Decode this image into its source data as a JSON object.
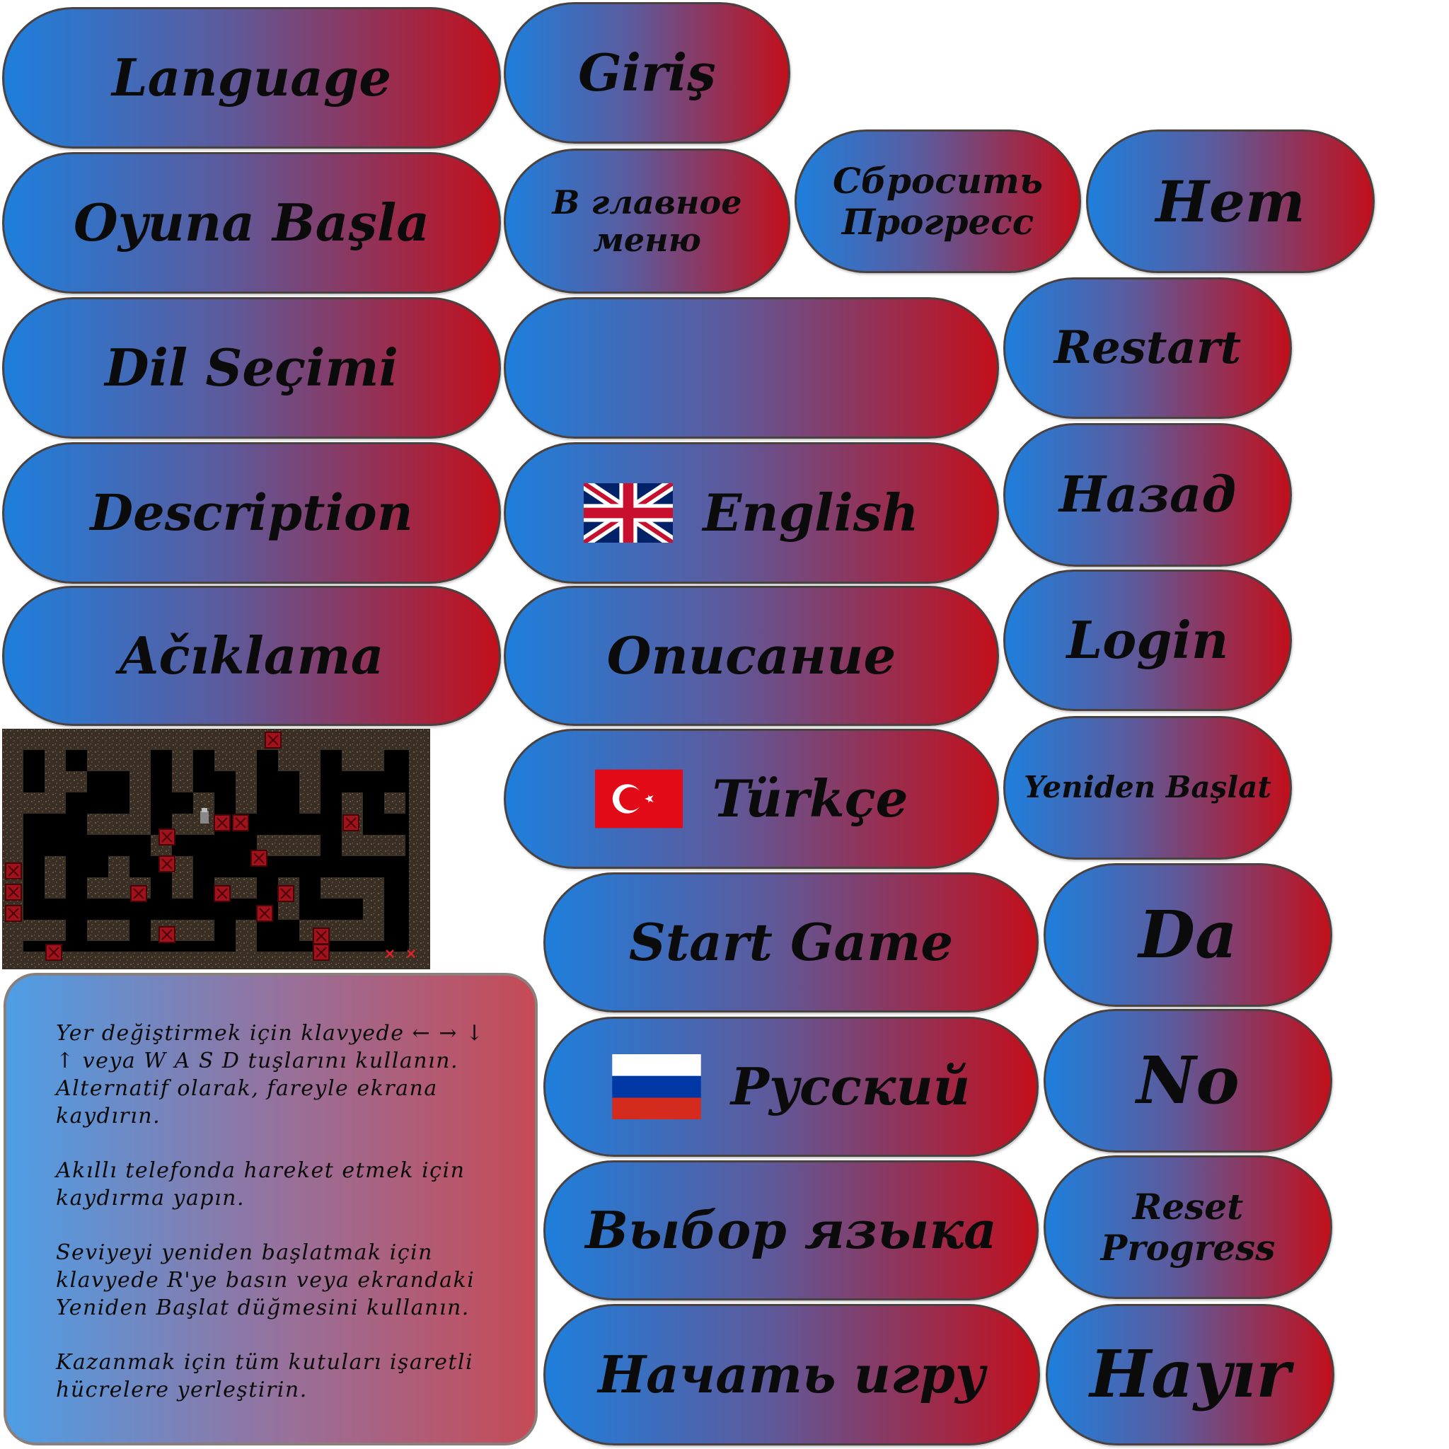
{
  "buttons": {
    "language": "Language",
    "giris": "Giriş",
    "oyuna_basla": "Oyuna Başla",
    "main_menu_ru": "В главное\nменю",
    "reset_progress_ru": "Сбросить\nПрогресс",
    "net_ru": "Нет",
    "dil_secimi": "Dil Seçimi",
    "blank": "",
    "restart": "Restart",
    "description": "Description",
    "english": "English",
    "nazad_ru": "Назад",
    "aciklama": "Ačıklama",
    "opisanie_ru": "Описание",
    "login": "Login",
    "turkce": "Türkçe",
    "yeniden_baslat": "Yeniden Başlat",
    "start_game": "Start Game",
    "da": "Da",
    "russkiy": "Русский",
    "no": "No",
    "vybor_yazyka_ru": "Выбор языка",
    "reset_progress": "Reset\nProgress",
    "nachat_igru_ru": "Начать игру",
    "hayir": "Hayır"
  },
  "description_paragraphs": [
    "Yer değiştirmek için klavyede ← → ↓\n↑ veya W A S D tuşlarını kullanın.\nAlternatif olarak, fareyle ekrana\nkaydırın.",
    "Akıllı telefonda hareket etmek için\nkaydırma yapın.",
    "Seviyeyi yeniden başlatmak için\nklavyede R'ye basın veya ekrandaki\nYeniden Başlat düğmesini kullanın.",
    "Kazanmak için tüm kutuları işaretli\nhücrelere yerleştirin."
  ],
  "colors": {
    "gradient_left": "#1e7fdc",
    "gradient_right": "#c20f1b",
    "border": "#4a4240"
  },
  "icons": [
    "uk-flag-icon",
    "turkey-flag-icon",
    "russia-flag-icon"
  ]
}
